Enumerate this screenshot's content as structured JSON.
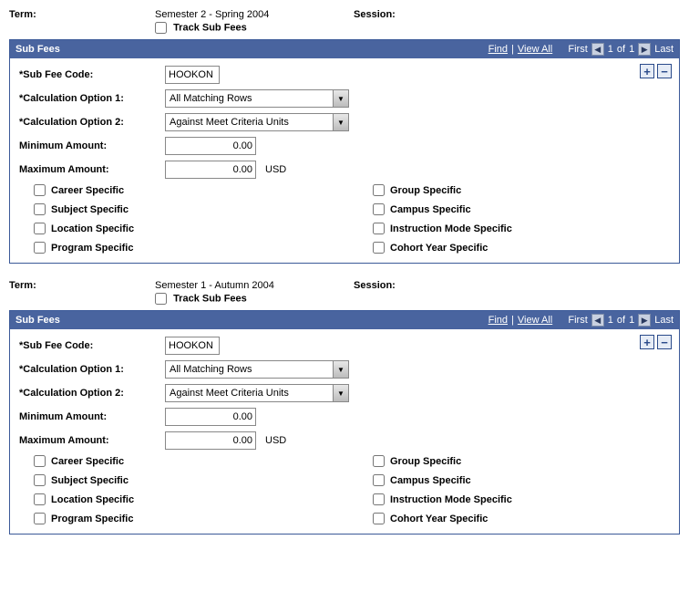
{
  "labels": {
    "term": "Term:",
    "session": "Session:",
    "track_sub_fees": "Track Sub Fees",
    "sub_fees": "Sub Fees",
    "find": "Find",
    "view_all": "View All",
    "first": "First",
    "of": "of",
    "last": "Last",
    "sub_fee_code": "*Sub Fee Code:",
    "calc_opt_1": "*Calculation Option 1:",
    "calc_opt_2": "*Calculation Option 2:",
    "min_amount": "Minimum Amount:",
    "max_amount": "Maximum Amount:",
    "career_specific": "Career Specific",
    "subject_specific": "Subject Specific",
    "location_specific": "Location Specific",
    "program_specific": "Program Specific",
    "group_specific": "Group Specific",
    "campus_specific": "Campus Specific",
    "instruction_mode_specific": "Instruction Mode Specific",
    "cohort_year_specific": "Cohort Year Specific"
  },
  "blocks": [
    {
      "term_value": "Semester 2 - Spring 2004",
      "session_value": "",
      "track": false,
      "nav": {
        "page": "1",
        "total": "1"
      },
      "sub_fee_code": "HOOKON",
      "calc_opt_1": "All Matching Rows",
      "calc_opt_2": "Against Meet Criteria Units",
      "min_amount": "0.00",
      "max_amount": "0.00",
      "currency": "USD",
      "checks": {
        "career": false,
        "subject": false,
        "location": false,
        "program": false,
        "group": false,
        "campus": false,
        "instruction": false,
        "cohort": false
      }
    },
    {
      "term_value": "Semester 1 - Autumn 2004",
      "session_value": "",
      "track": false,
      "nav": {
        "page": "1",
        "total": "1"
      },
      "sub_fee_code": "HOOKON",
      "calc_opt_1": "All Matching Rows",
      "calc_opt_2": "Against Meet Criteria Units",
      "min_amount": "0.00",
      "max_amount": "0.00",
      "currency": "USD",
      "checks": {
        "career": false,
        "subject": false,
        "location": false,
        "program": false,
        "group": false,
        "campus": false,
        "instruction": false,
        "cohort": false
      }
    }
  ]
}
